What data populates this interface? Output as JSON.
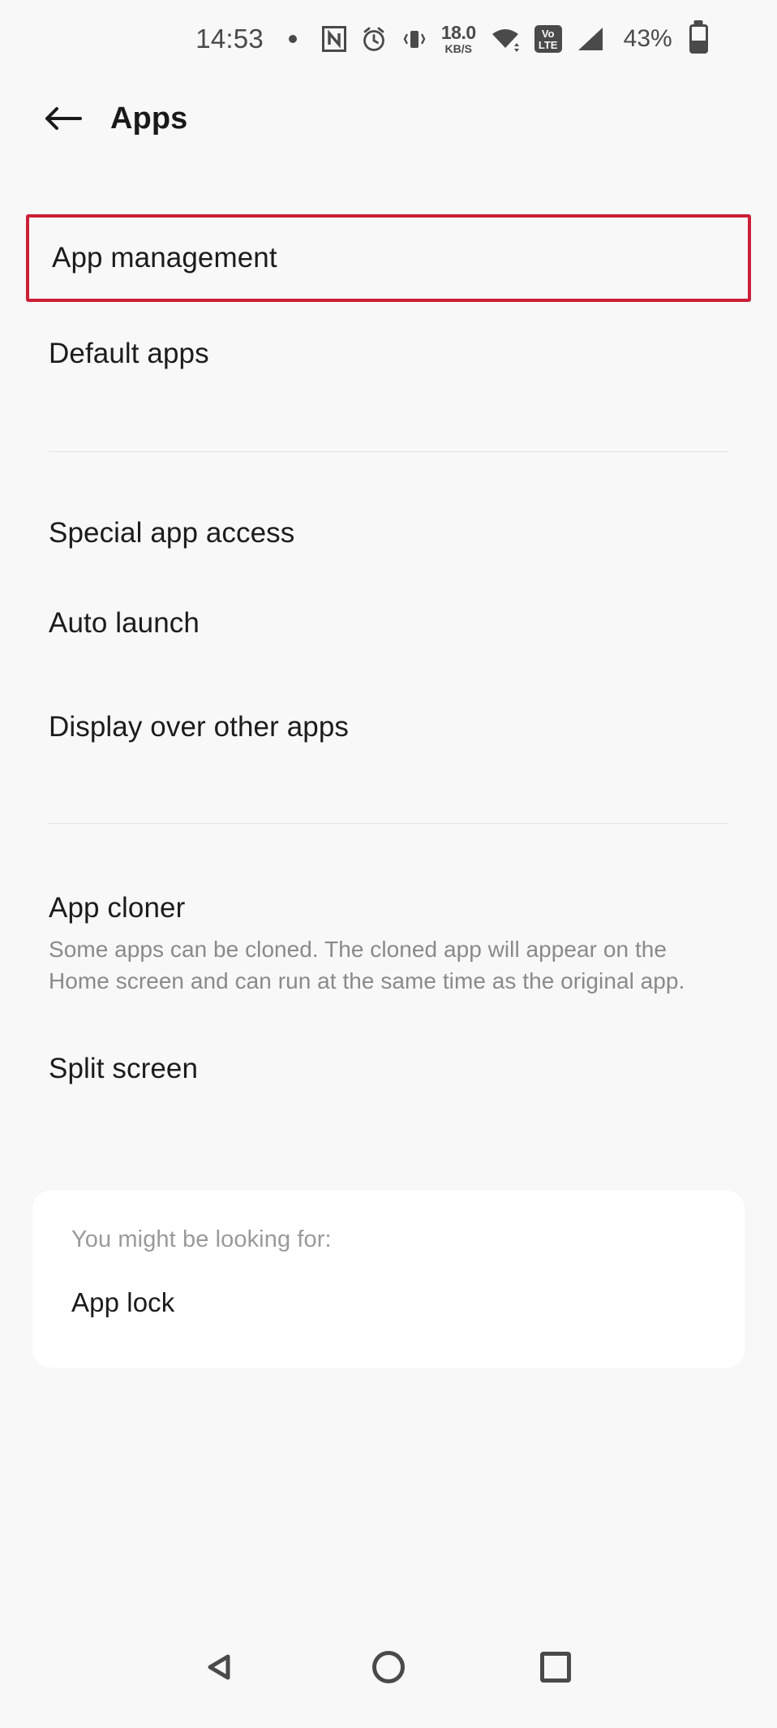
{
  "status_bar": {
    "time": "14:53",
    "network_speed_value": "18.0",
    "network_speed_unit": "KB/S",
    "volte_line1": "Vo",
    "volte_line2": "LTE",
    "battery_percent": "43%",
    "icons": [
      "dot-indicator-icon",
      "nfc-icon",
      "alarm-clock-icon",
      "vibrate-icon",
      "network-speed-icon",
      "wifi-icon",
      "volte-icon",
      "cellular-signal-icon",
      "battery-icon"
    ]
  },
  "header": {
    "back_label": "back-arrow",
    "title": "Apps"
  },
  "settings": {
    "group1": [
      {
        "title": "App management",
        "highlighted": true
      },
      {
        "title": "Default apps",
        "highlighted": false
      }
    ],
    "group2": [
      {
        "title": "Special app access"
      },
      {
        "title": "Auto launch"
      },
      {
        "title": "Display over other apps"
      }
    ],
    "group3": [
      {
        "title": "App cloner",
        "description": "Some apps can be cloned. The cloned app will appear on the Home screen and can run at the same time as the original app."
      },
      {
        "title": "Split screen"
      }
    ]
  },
  "suggestion_card": {
    "label": "You might be looking for:",
    "item": "App lock"
  },
  "nav_bar": {
    "back": "back-triangle-icon",
    "home": "home-circle-icon",
    "recents": "recents-square-icon"
  },
  "colors": {
    "highlight_red": "#cc1f38",
    "background": "#f8f8f8",
    "card_background": "#ffffff",
    "primary_text": "#1c1c1c",
    "secondary_text": "#8a8a8a",
    "icon_gray": "#4a4a4a"
  }
}
